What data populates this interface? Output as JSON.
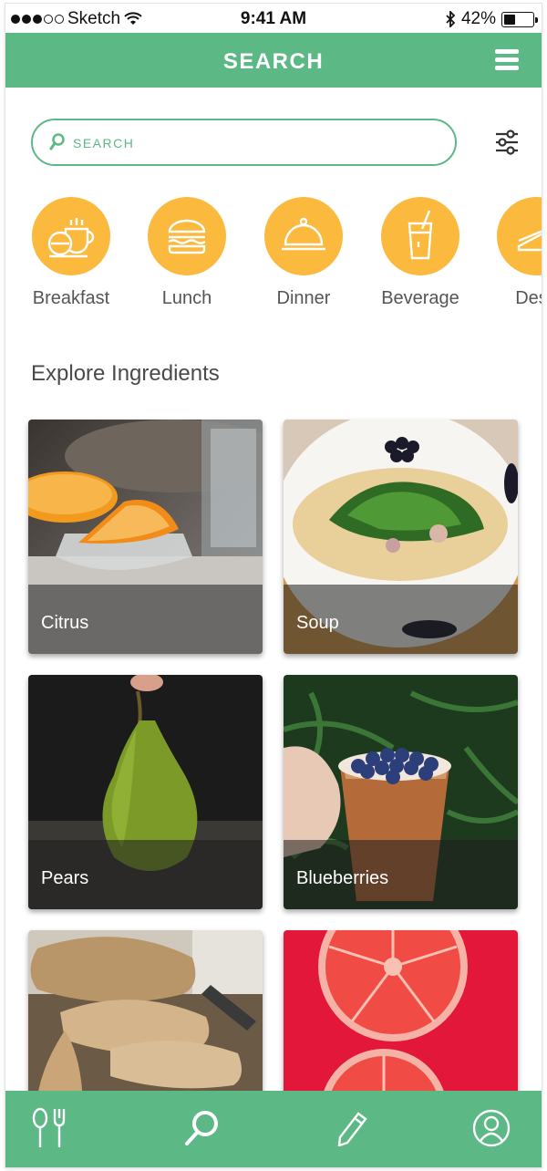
{
  "status_bar": {
    "carrier": "Sketch",
    "time": "9:41 AM",
    "battery": "42%",
    "battery_level": 0.42
  },
  "header": {
    "title": "SEARCH",
    "menu_icon": "hamburger-menu-icon"
  },
  "search": {
    "placeholder": "SEARCH",
    "value": "",
    "filter_icon": "sliders-icon"
  },
  "categories": [
    {
      "label": "Breakfast",
      "icon": "breakfast-icon"
    },
    {
      "label": "Lunch",
      "icon": "burger-icon"
    },
    {
      "label": "Dinner",
      "icon": "cloche-icon"
    },
    {
      "label": "Beverage",
      "icon": "drink-icon"
    },
    {
      "label": "Dess",
      "icon": "cake-icon"
    }
  ],
  "section": {
    "title": "Explore Ingredients"
  },
  "ingredients": [
    {
      "label": "Citrus"
    },
    {
      "label": "Soup"
    },
    {
      "label": "Pears"
    },
    {
      "label": "Blueberries"
    },
    {
      "label": ""
    },
    {
      "label": ""
    }
  ],
  "tab_bar": {
    "items": [
      "cutlery-icon",
      "search-icon",
      "pencil-icon",
      "profile-icon"
    ],
    "active": "search-icon"
  },
  "colors": {
    "brand_green": "#5cb885",
    "category_orange": "#fbb93e"
  }
}
